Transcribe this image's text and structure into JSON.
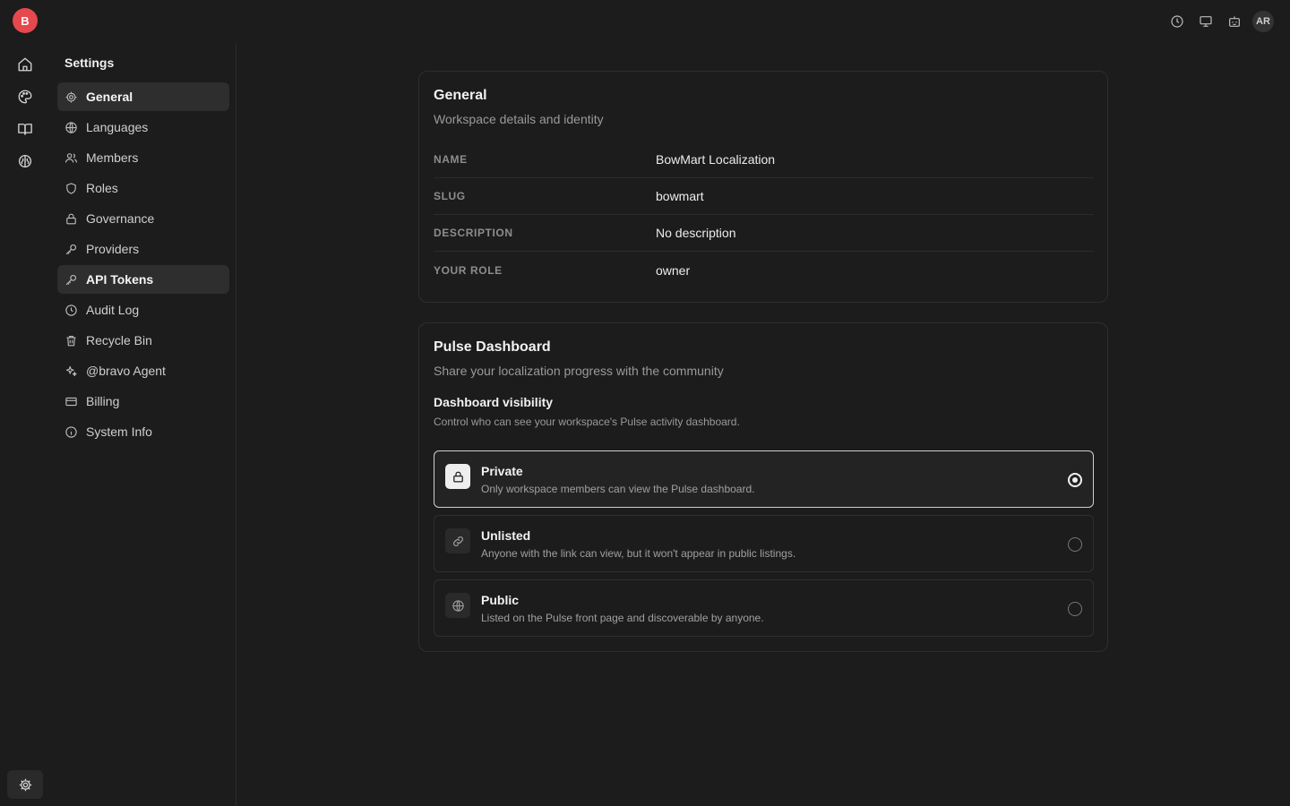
{
  "rail": {
    "brand_initial": "B",
    "items": [
      {
        "icon": "home-icon"
      },
      {
        "icon": "palette-icon"
      },
      {
        "icon": "book-icon"
      },
      {
        "icon": "brain-icon"
      }
    ],
    "settings_icon": "gear-icon"
  },
  "topbar": {
    "icons": [
      "clock-icon",
      "monitor-icon",
      "bot-icon"
    ],
    "avatar_initials": "AR"
  },
  "nav": {
    "title": "Settings",
    "items": [
      {
        "label": "General",
        "icon": "gear-icon",
        "active": true
      },
      {
        "label": "Languages",
        "icon": "globe-icon",
        "active": false
      },
      {
        "label": "Members",
        "icon": "users-icon",
        "active": false
      },
      {
        "label": "Roles",
        "icon": "shield-icon",
        "active": false
      },
      {
        "label": "Governance",
        "icon": "lock-icon",
        "active": false
      },
      {
        "label": "Providers",
        "icon": "key-icon",
        "active": false
      },
      {
        "label": "API Tokens",
        "icon": "key-icon",
        "active": true
      },
      {
        "label": "Audit Log",
        "icon": "clock-icon",
        "active": false
      },
      {
        "label": "Recycle Bin",
        "icon": "trash-icon",
        "active": false
      },
      {
        "label": "@bravo Agent",
        "icon": "sparkles-icon",
        "active": false
      },
      {
        "label": "Billing",
        "icon": "credit-card-icon",
        "active": false
      },
      {
        "label": "System Info",
        "icon": "info-icon",
        "active": false
      }
    ]
  },
  "general": {
    "title": "General",
    "subtitle": "Workspace details and identity",
    "fields": [
      {
        "label": "NAME",
        "value": "BowMart Localization"
      },
      {
        "label": "SLUG",
        "value": "bowmart"
      },
      {
        "label": "DESCRIPTION",
        "value": "No description"
      },
      {
        "label": "YOUR ROLE",
        "value": "owner"
      }
    ]
  },
  "pulse": {
    "title": "Pulse Dashboard",
    "subtitle": "Share your localization progress with the community",
    "visibility_title": "Dashboard visibility",
    "visibility_sub": "Control who can see your workspace's Pulse activity dashboard.",
    "selected": "private",
    "options": [
      {
        "id": "private",
        "icon": "lock-icon",
        "title": "Private",
        "desc": "Only workspace members can view the Pulse dashboard."
      },
      {
        "id": "unlisted",
        "icon": "link-icon",
        "title": "Unlisted",
        "desc": "Anyone with the link can view, but it won't appear in public listings."
      },
      {
        "id": "public",
        "icon": "globe-icon",
        "title": "Public",
        "desc": "Listed on the Pulse front page and discoverable by anyone."
      }
    ]
  }
}
